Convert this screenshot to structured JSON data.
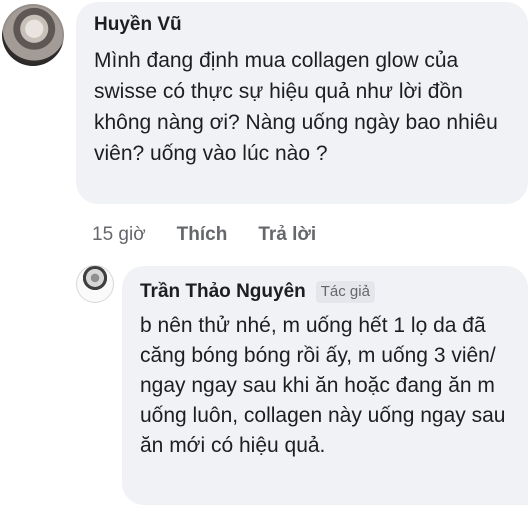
{
  "comment": {
    "author": "Huyền Vũ",
    "text": "Mình đang định mua collagen glow của swisse có thực sự hiệu quả như lời đồn không nàng ơi? Nàng uống ngày bao nhiêu viên? uống vào lúc nào ?",
    "time": "15 giờ",
    "like_label": "Thích",
    "reply_label": "Trả lời"
  },
  "reply": {
    "author": "Trần Thảo Nguyên",
    "author_tag": "Tác giả",
    "text": "b nên thử nhé, m uống hết 1 lọ da đã căng bóng bóng rồi ấy, m uống 3 viên/ ngay ngay sau khi ăn hoặc đang ăn m uống luôn, collagen này uống ngay sau ăn mới có hiệu quả."
  }
}
